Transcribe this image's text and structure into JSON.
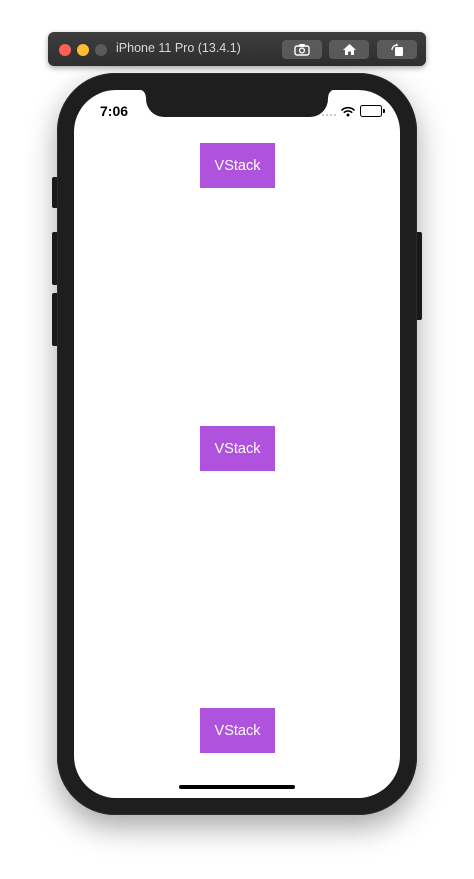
{
  "window": {
    "title": "iPhone 11 Pro (13.4.1)",
    "toolbar_icons": [
      "screenshot-icon",
      "home-icon",
      "rotate-icon"
    ]
  },
  "status_bar": {
    "time": "7:06",
    "icons": [
      "cellular-icon",
      "wifi-icon",
      "battery-icon"
    ]
  },
  "content": {
    "box_color": "#af52de",
    "boxes": [
      {
        "label": "VStack"
      },
      {
        "label": "VStack"
      },
      {
        "label": "VStack"
      }
    ]
  }
}
